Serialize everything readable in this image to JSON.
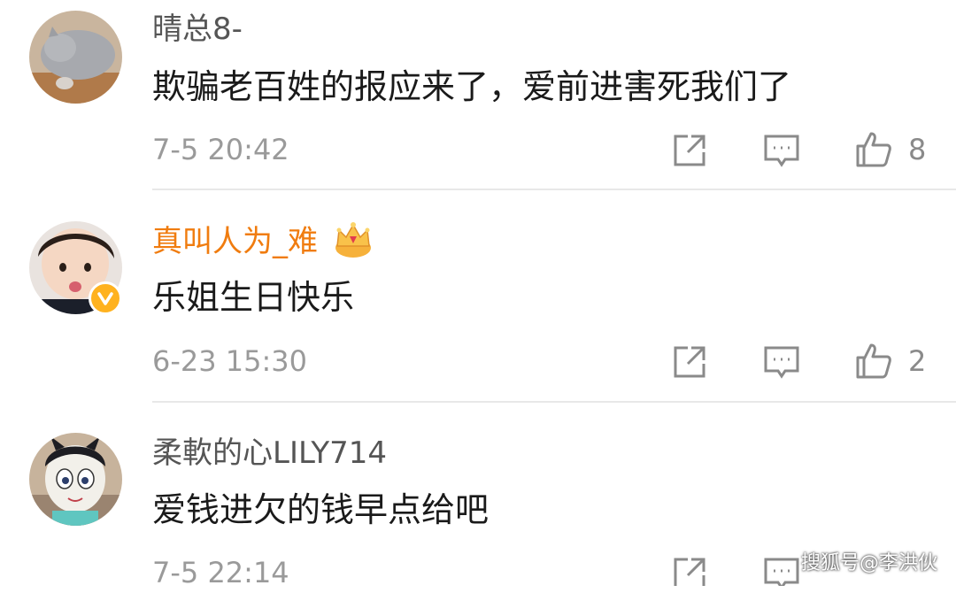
{
  "comments": [
    {
      "username": "晴总8-",
      "content": "欺骗老百姓的报应来了，爱前进害死我们了",
      "time": "7-5 20:42",
      "likes": "8"
    },
    {
      "username": "真叫人为_难",
      "content": "乐姐生日快乐",
      "time": "6-23 15:30",
      "likes": "2",
      "verified": true,
      "vip_crown": true
    },
    {
      "username": "柔軟的心LILY714",
      "content": "爱钱进欠的钱早点给吧",
      "time": "7-5 22:14"
    }
  ],
  "icons": {
    "share": "share-icon",
    "reply": "comment-icon",
    "like": "thumbs-up-icon"
  },
  "colors": {
    "vip_name": "#f07c0f",
    "verified_badge": "#ffb21f"
  },
  "watermark": "搜狐号@李洪伙"
}
